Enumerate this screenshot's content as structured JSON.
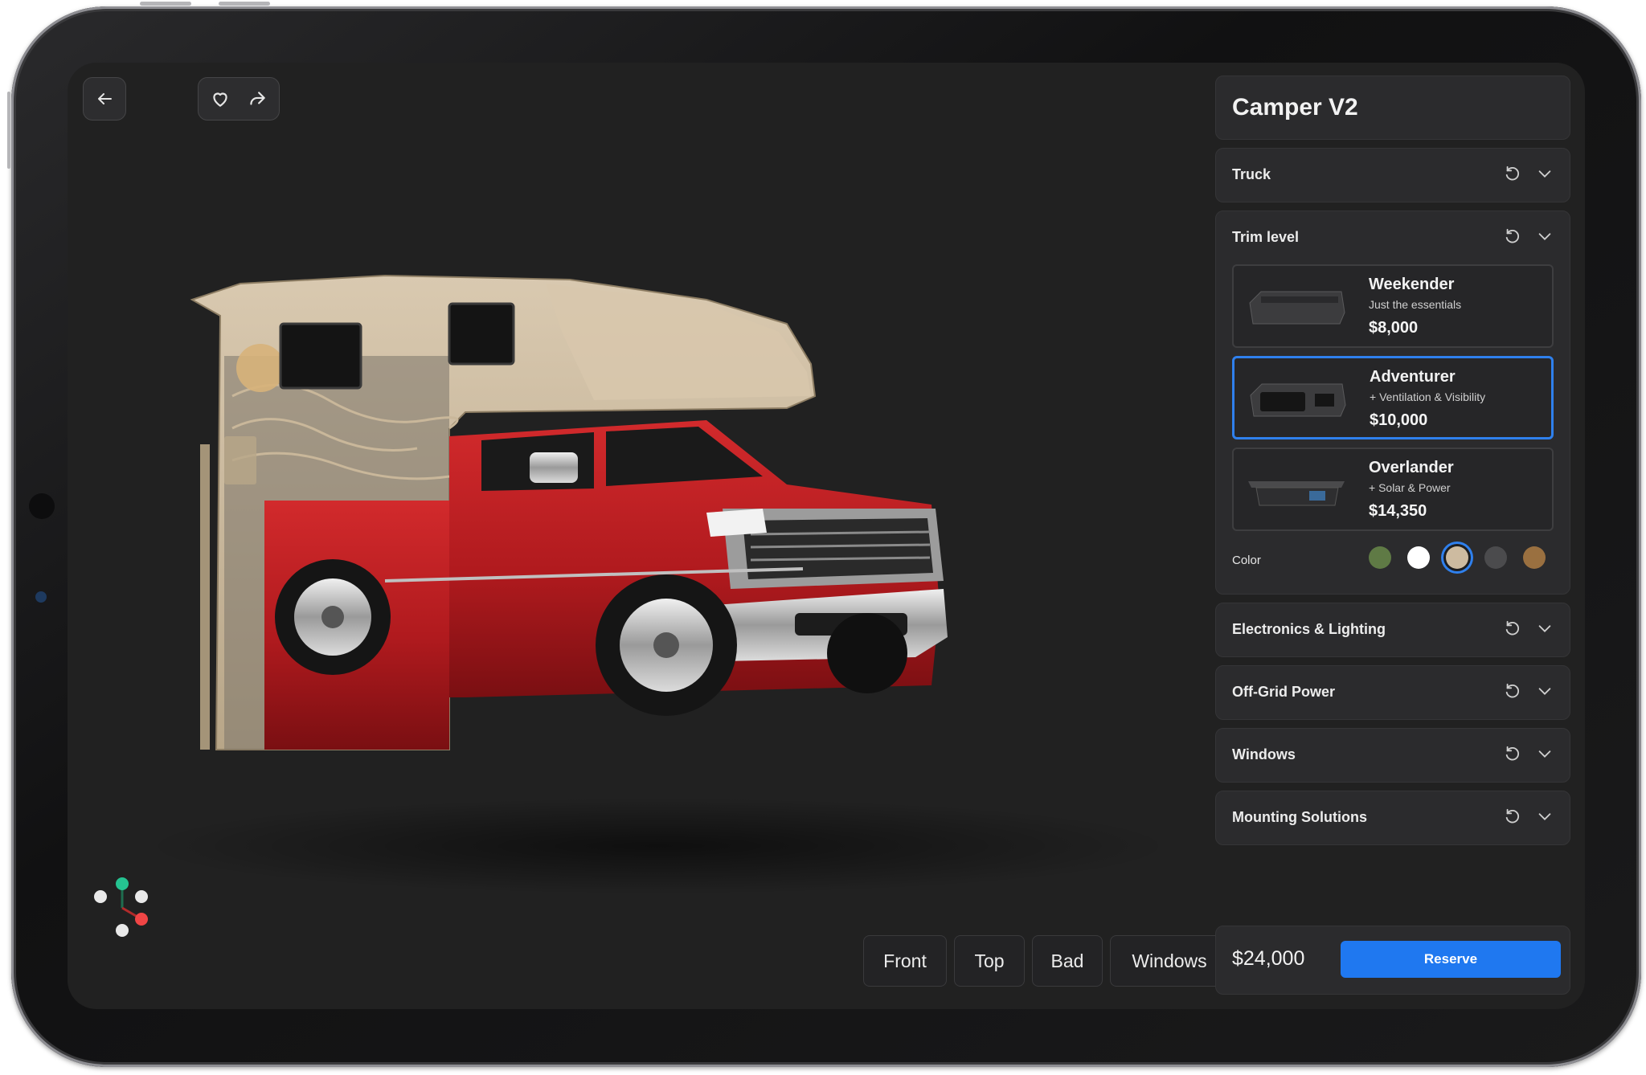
{
  "app": {
    "title": "Camper V2"
  },
  "topbar": {
    "back_icon": "arrow-left-icon",
    "favorite_icon": "heart-icon",
    "share_icon": "share-arrow-icon"
  },
  "sections": [
    {
      "label": "Truck",
      "reset_icon": "reset-icon",
      "expand_icon": "chevron-down-icon"
    },
    {
      "label": "Trim level",
      "reset_icon": "reset-icon",
      "expand_icon": "chevron-down-icon"
    },
    {
      "label": "Electronics & Lighting",
      "reset_icon": "reset-icon",
      "expand_icon": "chevron-down-icon"
    },
    {
      "label": "Off-Grid Power",
      "reset_icon": "reset-icon",
      "expand_icon": "chevron-down-icon"
    },
    {
      "label": "Windows",
      "reset_icon": "reset-icon",
      "expand_icon": "chevron-down-icon"
    },
    {
      "label": "Mounting Solutions",
      "reset_icon": "reset-icon",
      "expand_icon": "chevron-down-icon"
    }
  ],
  "trims": [
    {
      "name": "Weekender",
      "desc": "Just the essentials",
      "price": "$8,000",
      "selected": false
    },
    {
      "name": "Adventurer",
      "desc": "+ Ventilation & Visibility",
      "price": "$10,000",
      "selected": true
    },
    {
      "name": "Overlander",
      "desc": "+ Solar & Power",
      "price": "$14,350",
      "selected": false
    }
  ],
  "color": {
    "label": "Color",
    "swatches": [
      "#5f7a45",
      "#ffffff",
      "#cdbba0",
      "#4b4b4d",
      "#9a7040"
    ],
    "selected_index": 2
  },
  "views": [
    "Front",
    "Top",
    "Bad",
    "Windows"
  ],
  "footer": {
    "total": "$24,000",
    "reserve_label": "Reserve"
  },
  "colors": {
    "accent": "#1f78f0",
    "truck_red": "#b01a1e",
    "camper_tan": "#cdbba0",
    "screen_bg": "#212121"
  },
  "axis_gizmo_icon": "axis-gizmo-icon"
}
